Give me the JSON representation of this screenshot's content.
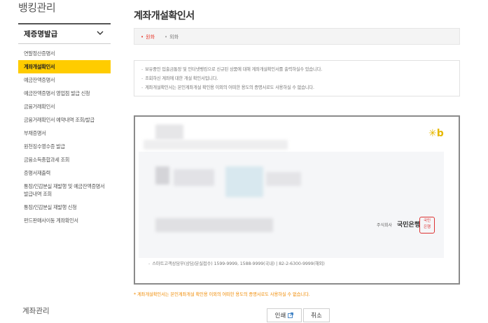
{
  "sidebar": {
    "title": "뱅킹관리",
    "section_label": "제증명발급",
    "items": [
      {
        "label": "연말정산증명서"
      },
      {
        "label": "계좌개설확인서"
      },
      {
        "label": "예금잔액증명서"
      },
      {
        "label": "예금잔액증명서 영업점 발급 신청"
      },
      {
        "label": "금융거래확인서"
      },
      {
        "label": "금융거래확인서 예약내역 조회/발급"
      },
      {
        "label": "부채증명서"
      },
      {
        "label": "원천징수영수증 발급"
      },
      {
        "label": "금융소득종합과세 조회"
      },
      {
        "label": "증명서재출력"
      },
      {
        "label": "통장/인감분실 재발행 및 예금잔액증명서 발급내역 조회"
      },
      {
        "label": "통장/인감분실 재발행 신청"
      },
      {
        "label": "펀드판매사이동 계좌확인서"
      }
    ],
    "active_index": 1,
    "footer_label": "계좌관리"
  },
  "main": {
    "title": "계좌개설확인서",
    "tabs": [
      {
        "label": "원화",
        "active": true
      },
      {
        "label": "외화",
        "active": false
      }
    ],
    "notices": [
      "보유중인 입출금통장 및 인터넷뱅킹으로 신규된 상품에 대해 계좌개설확인서를 출력하실수 있습니다.",
      "조회하신 계좌에 대한 개설 확인서입니다.",
      "계좌개설확인서는 본인계좌개설 확인용 이외의 어떠한 용도의 증명서로도 사용하실 수 없습니다."
    ],
    "certificate": {
      "bank_label": "주식회사",
      "bank_name": "국민은행",
      "seal_text": [
        "국민",
        "은행"
      ],
      "logo_icon": "kb-star-logo",
      "contact": "스마트고객상담부(상담/분실접수) 1599-9999, 1588-9999(국내) | 82-2-6300-9999(해외)"
    },
    "warning": "* 계좌개설확인서는 본인계좌개설 확인용 이외의 어떠한 용도의 증명서로도 사용하실 수 없습니다.",
    "buttons": {
      "print_label": "인쇄",
      "cancel_label": "취소"
    }
  },
  "colors": {
    "active_tab": "#e8382b",
    "sidebar_active_bg": "#ffcc00",
    "warning_text": "#f08a00",
    "logo": "#e6b800"
  }
}
